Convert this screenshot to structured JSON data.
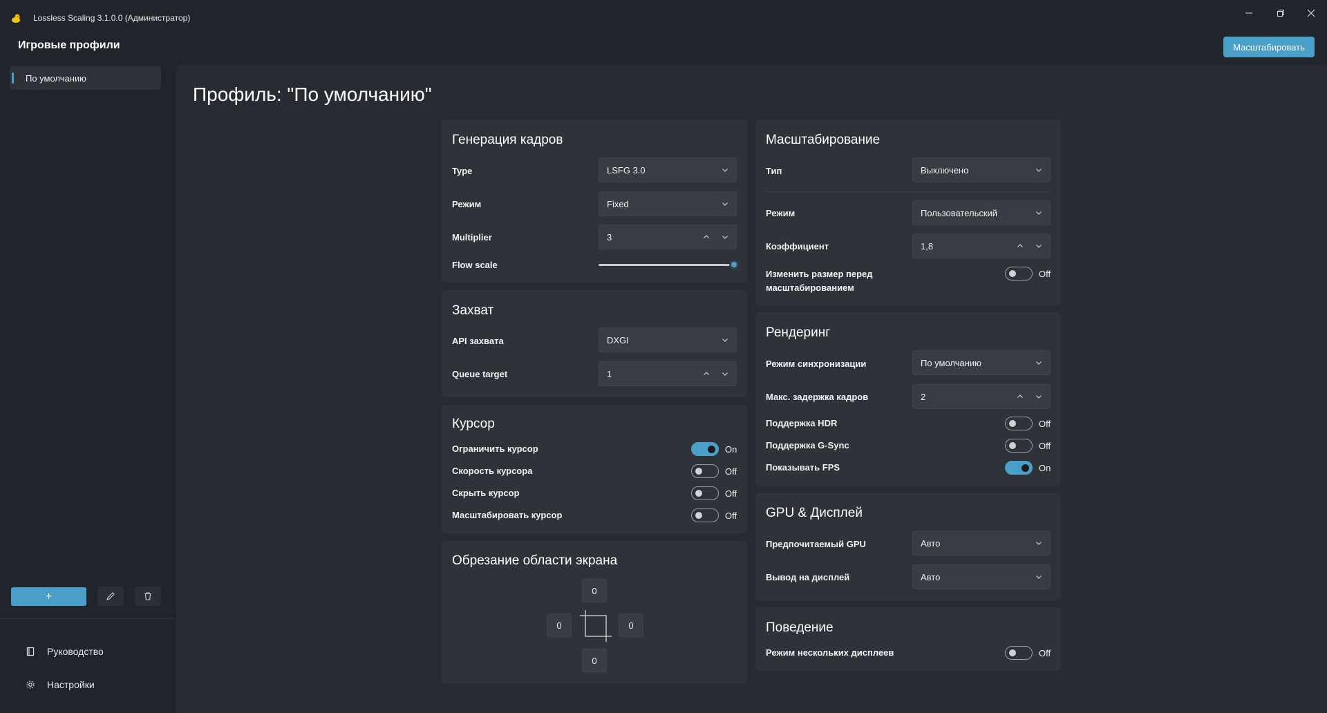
{
  "window": {
    "title": "Lossless Scaling 3.1.0.0 (Администратор)"
  },
  "sidebar": {
    "title": "Игровые профили",
    "profiles": [
      {
        "label": "По умолчанию"
      }
    ],
    "add_label": "+",
    "nav": [
      {
        "label": "Руководство",
        "icon": "book-icon"
      },
      {
        "label": "Настройки",
        "icon": "gear-icon"
      }
    ]
  },
  "header": {
    "scale_button": "Масштабировать"
  },
  "page": {
    "title": "Профиль: \"По умолчанию\""
  },
  "frame_gen": {
    "title": "Генерация кадров",
    "type_label": "Type",
    "type_value": "LSFG 3.0",
    "mode_label": "Режим",
    "mode_value": "Fixed",
    "multiplier_label": "Multiplier",
    "multiplier_value": "3",
    "flow_label": "Flow scale",
    "flow_value": 1.0
  },
  "capture": {
    "title": "Захват",
    "api_label": "API захвата",
    "api_value": "DXGI",
    "queue_label": "Queue target",
    "queue_value": "1"
  },
  "cursor": {
    "title": "Курсор",
    "items": [
      {
        "label": "Ограничить курсор",
        "state": "On"
      },
      {
        "label": "Скорость курсора",
        "state": "Off"
      },
      {
        "label": "Скрыть курсор",
        "state": "Off"
      },
      {
        "label": "Масштабировать курсор",
        "state": "Off"
      }
    ]
  },
  "crop": {
    "title": "Обрезание области экрана",
    "top": "0",
    "left": "0",
    "right": "0",
    "bottom": "0"
  },
  "scaling": {
    "title": "Масштабирование",
    "type_label": "Тип",
    "type_value": "Выключено",
    "mode_label": "Режим",
    "mode_value": "Пользовательский",
    "factor_label": "Коэффициент",
    "factor_value": "1,8",
    "resize_label_1": "Изменить размер перед",
    "resize_label_2": "масштабированием",
    "resize_state": "Off"
  },
  "rendering": {
    "title": "Рендеринг",
    "sync_label": "Режим синхронизации",
    "sync_value": "По умолчанию",
    "latency_label": "Макс. задержка кадров",
    "latency_value": "2",
    "items": [
      {
        "label": "Поддержка HDR",
        "state": "Off"
      },
      {
        "label": "Поддержка G-Sync",
        "state": "Off"
      },
      {
        "label": "Показывать FPS",
        "state": "On"
      }
    ]
  },
  "gpu": {
    "title": "GPU & Дисплей",
    "gpu_label": "Предпочитаемый GPU",
    "gpu_value": "Авто",
    "display_label": "Вывод на дисплей",
    "display_value": "Авто"
  },
  "behavior": {
    "title": "Поведение",
    "multi_label": "Режим нескольких дисплеев",
    "multi_state": "Off"
  },
  "colors": {
    "accent": "#4a9fc9",
    "background": "#20252b",
    "card": "#2e3339"
  }
}
